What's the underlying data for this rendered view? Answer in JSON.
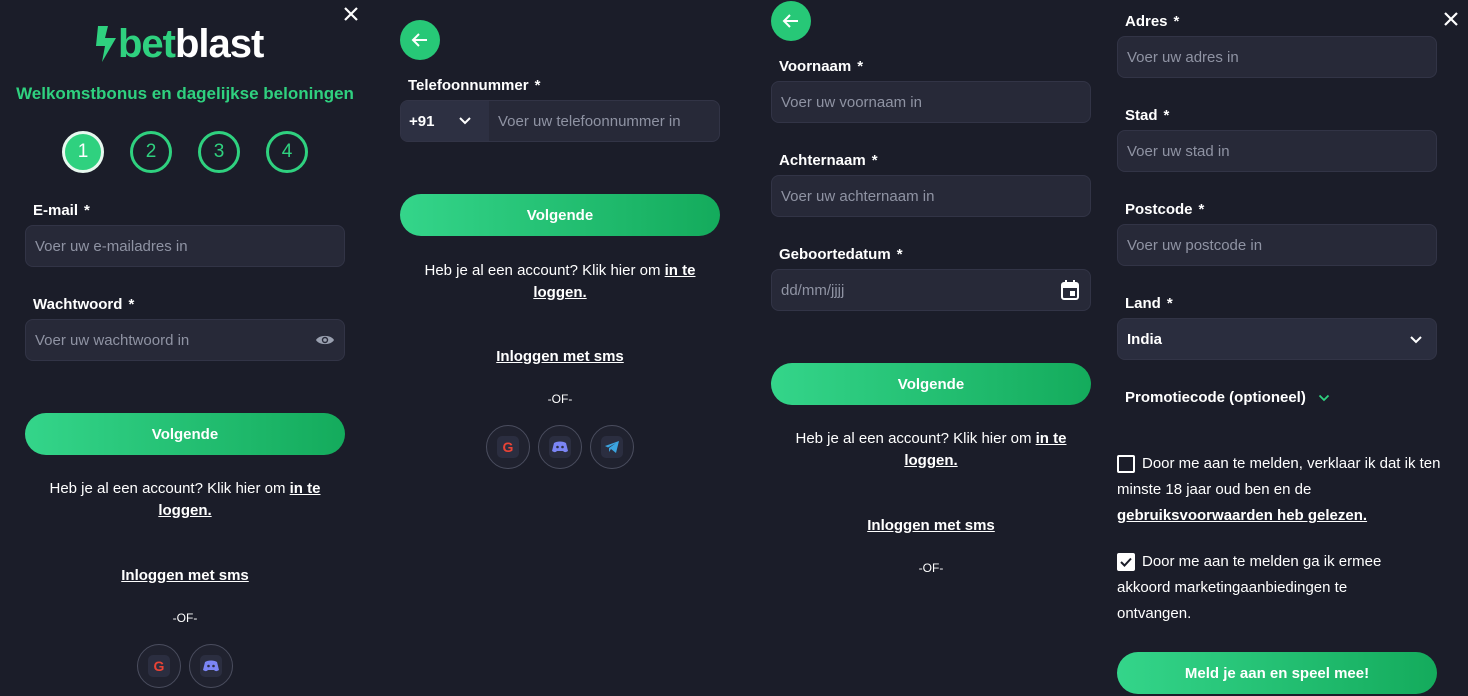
{
  "brand": {
    "logo_text_1": "bet",
    "logo_text_2": "blast",
    "accent": "#2fd17f"
  },
  "step1": {
    "subtitle": "Welkomstbonus en dagelijkse beloningen",
    "steps": [
      "1",
      "2",
      "3",
      "4"
    ],
    "email_label": "E-mail",
    "email_placeholder": "Voer uw e-mailadres in",
    "password_label": "Wachtwoord",
    "password_placeholder": "Voer uw wachtwoord in",
    "next_button": "Volgende",
    "account_text": "Heb je al een account? Klik hier om",
    "login_link": "in te loggen.",
    "sms_login": "Inloggen met sms",
    "or_text": "-OF-"
  },
  "step2": {
    "phone_label": "Telefoonnummer",
    "country_code": "+91",
    "phone_placeholder": "Voer uw telefoonnummer in",
    "next_button": "Volgende",
    "account_text": "Heb je al een account? Klik hier om",
    "login_link": "in te loggen.",
    "sms_login": "Inloggen met sms",
    "or_text": "-OF-"
  },
  "step3": {
    "firstname_label": "Voornaam",
    "firstname_placeholder": "Voer uw voornaam in",
    "lastname_label": "Achternaam",
    "lastname_placeholder": "Voer uw achternaam in",
    "birthdate_label": "Geboortedatum",
    "birthdate_placeholder": "dd/mm/jjjj",
    "next_button": "Volgende",
    "account_text": "Heb je al een account? Klik hier om",
    "login_link": "in te loggen.",
    "sms_login": "Inloggen met sms",
    "or_text": "-OF-"
  },
  "step4": {
    "address_label": "Adres",
    "address_placeholder": "Voer uw adres in",
    "city_label": "Stad",
    "city_placeholder": "Voer uw stad in",
    "postcode_label": "Postcode",
    "postcode_placeholder": "Voer uw postcode in",
    "country_label": "Land",
    "country_value": "India",
    "promo_label": "Promotiecode (optioneel)",
    "terms_text": "Door me aan te melden, verklaar ik dat ik ten minste 18 jaar oud ben en de",
    "terms_link": "gebruiksvoorwaarden heb gelezen.",
    "terms_checked": false,
    "marketing_text": "Door me aan te melden ga ik ermee akkoord marketingaanbiedingen te ontvangen.",
    "marketing_checked": true,
    "submit_button": "Meld je aan en speel mee!"
  },
  "required_marker": "*",
  "icons": [
    "close-icon",
    "back-arrow-icon",
    "eye-icon",
    "chevron-down-icon",
    "calendar-icon",
    "google-icon",
    "discord-icon",
    "telegram-icon"
  ]
}
